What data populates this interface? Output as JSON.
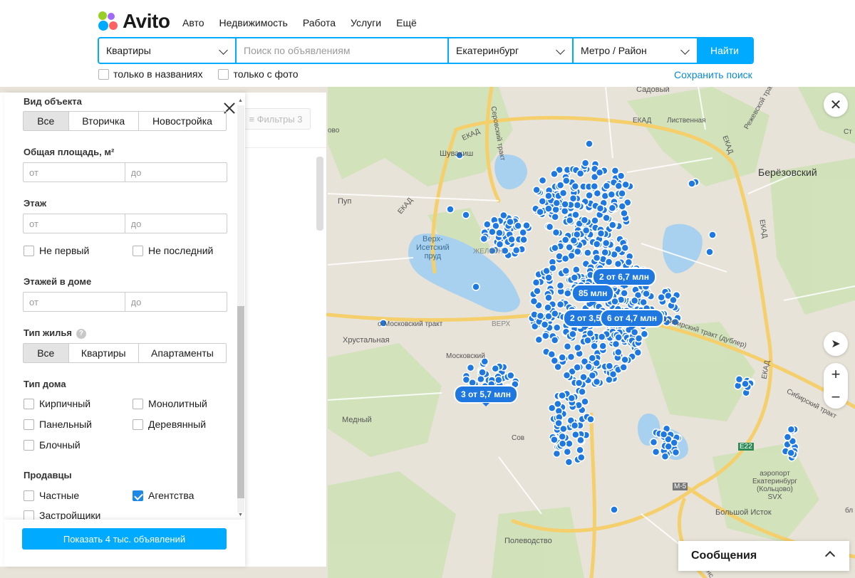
{
  "header": {
    "logo_text": "Avito",
    "nav": [
      "Авто",
      "Недвижимость",
      "Работа",
      "Услуги",
      "Ещё"
    ],
    "search": {
      "category": "Квартиры",
      "query_placeholder": "Поиск по объявлениям",
      "city": "Екатеринбург",
      "metro": "Метро / Район",
      "submit_label": "Найти"
    },
    "checkboxes": [
      {
        "label": "только в названиях",
        "checked": false
      },
      {
        "label": "только с фото",
        "checked": false
      }
    ],
    "save_search_label": "Сохранить поиск"
  },
  "list": {
    "filters_chip": "≡ Фильтры 3"
  },
  "filter": {
    "object_type": {
      "title": "Вид объекта",
      "options": [
        "Все",
        "Вторичка",
        "Новостройка"
      ],
      "selected": "Все"
    },
    "area": {
      "title": "Общая площадь, м²",
      "from_placeholder": "от",
      "to_placeholder": "до"
    },
    "floor": {
      "title": "Этаж",
      "from_placeholder": "от",
      "to_placeholder": "до",
      "not_first": "Не первый",
      "not_last": "Не последний"
    },
    "floors_in_house": {
      "title": "Этажей в доме",
      "from_placeholder": "от",
      "to_placeholder": "до"
    },
    "housing_type": {
      "title": "Тип жилья",
      "help": "?",
      "options": [
        "Все",
        "Квартиры",
        "Апартаменты"
      ],
      "selected": "Все"
    },
    "house_type": {
      "title": "Тип дома",
      "options": [
        {
          "label": "Кирпичный",
          "checked": false
        },
        {
          "label": "Монолитный",
          "checked": false
        },
        {
          "label": "Панельный",
          "checked": false
        },
        {
          "label": "Деревянный",
          "checked": false
        },
        {
          "label": "Блочный",
          "checked": false
        }
      ]
    },
    "sellers": {
      "title": "Продавцы",
      "options": [
        {
          "label": "Частные",
          "checked": false
        },
        {
          "label": "Агентства",
          "checked": true
        },
        {
          "label": "Застройщики",
          "checked": false
        }
      ]
    },
    "show_button": "Показать 4 тыс. объявлений"
  },
  "map": {
    "clusters": [
      "2 от 6,7 млн",
      "85 млн",
      "2 от 3,5",
      "6 от 4,7 млн",
      "3 от 5,7 млн"
    ],
    "labels": {
      "sadovy": "Садовый",
      "berezovsky": "Берёзовский",
      "shuvakish": "Шувакиш",
      "pup": "Пуп",
      "verkh_isetsky": "Верх-\nИсетский\nпруд",
      "khrustalnaya": "Хрустальная",
      "medny": "Медный",
      "polevodstvo": "Полеводство",
      "bolshoy_istok": "Большой Исток",
      "airport": "аэропорт\nЕкатеринбург\n(Кольцово)\nSVX",
      "listvennaya": "Лиственная",
      "moskovsky_trakt": "о-Московский тракт",
      "moskovsky": "Московский",
      "sibirsky_trakt": "Сибирский тракт (дублер)",
      "sibirsky_trakt2": "Сибирский тракт",
      "serovsky_trakt": "Серовский тракт",
      "ekad": "ЕКАД",
      "rezhevskoy": "Режевской тракт",
      "m5": "М-5",
      "e22": "E22",
      "chelyab": "Челябинс",
      "ivo": "ово",
      "zelezn": "ЖЕЛЕЗН",
      "verkh": "ВЕРХ",
      "sov": "Сов",
      "st": "Ст",
      "bl": "бл"
    },
    "zoom_in": "+",
    "zoom_out": "−"
  },
  "messages": {
    "label": "Сообщения"
  },
  "colors": {
    "accent": "#00aaff",
    "marker": "#1e78e0",
    "link": "#0a8ad6"
  }
}
